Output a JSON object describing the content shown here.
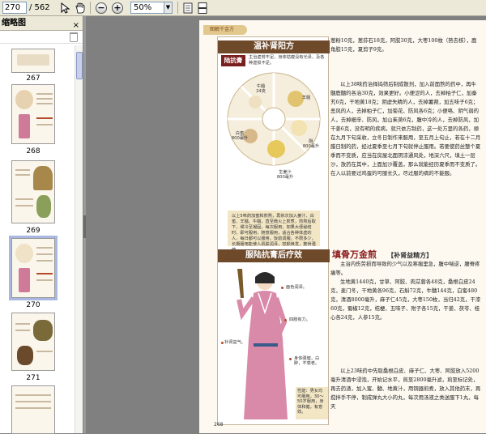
{
  "toolbar": {
    "page_current": "270",
    "page_total": "/ 562",
    "zoom_value": "50%",
    "zoom_out_label": "−",
    "zoom_in_label": "+",
    "zoom_arrow": "▼"
  },
  "sidebar": {
    "title": "缩略图",
    "close_label": "×",
    "thumbnails": [
      {
        "label": "267"
      },
      {
        "label": "268"
      },
      {
        "label": "269"
      },
      {
        "label": "270"
      },
      {
        "label": "271"
      }
    ]
  },
  "page": {
    "section_tab": "图解千金方",
    "box_title": "温补肾阳方",
    "tag": "陆抗膏",
    "tag_note": "主治虚劳不足，身体枯瘦没有光泽，及各种虚损不足。",
    "herbs": [
      {
        "label": "牛髓\n24克"
      },
      {
        "label": "羊髓\n"
      },
      {
        "label": "白蜜\n800毫升"
      },
      {
        "label": "生姜汁\n800毫升"
      },
      {
        "label": "酥\n800毫升"
      }
    ],
    "desc_text": "以上5味药加蜜和煎熬，再依次加入姜汁、白蜜、羊髓、牛髓，直至微火上煎煮，煎熬后取下，候冷至凝固，每次服用，如果大便秘结时，即可服用，随意服用，适合各种体虚的人，每日都可以服用，饭前调服。不限多少，长期服用能使人肌肤润泽，容颜焕发，筋骨强健。",
    "box_title_2": "服陆抗膏后疗效",
    "annotations": [
      {
        "label": "面色润泽。"
      },
      {
        "label": "四肢有力。"
      },
      {
        "label": "补肾益气。"
      },
      {
        "label": "身体强健，白胖，不衰老。"
      }
    ],
    "note_text": "性能：男女均可服用，30～50岁服用，身体和健，有意效。",
    "right_top": "葱粉10克，葱荪石18克，阿胶30克，大枣100枚（熟去核），鹿角胶15克，夏剪子9克。",
    "right_body": "以上38味药治择捣筛后制成散剂，加入前面熬的药中，再牛髓鹿髓的各治30克，效果更好。小便涩的人，去掉柏子仁，加秦艽6克，干地黄18克；阴虚失精的人，去掉薯蓣，加五味子6克；恶风的人，去掉柏子仁，加菊花、防风各6克；小便咯、阴气弱的人，去掉细辛、防风，加山茱萸6克，腹中冷的人，去掉防风，加干姜6克，没有明的疾病，就只依方制药，这一处方里的各药，顺在九月下旬采收，立冬日制作来服用，至五月上旬止，若在十二月腊日制的药，经过夏季至七月下旬就停止服用。若要使药丝整个夏季而不变质，应当在房屋北面阴凉通风处，地深六尺，填土一层沙，放药在其中，上面加沙覆盖，那么就能经历夏季而不变质了。在入以前要过鸡蛋的可服长久，尽过服的病的不能服。",
    "heading_main": "填骨万金煎",
    "heading_sub": "【补肾益精方】",
    "right_lower": "主治内伤劳损而导致的少气以及寒痼里急，腹中喘逆，腰脊疼痛等。",
    "right_recipe": "生地黄1440克，甘草、阿胶、肉苁蓉各48克，桑根白皮24克，麦门冬，干地黄各96克，石斛72克，牛髓144克，白蜜480克，清酒8000毫升，麻子仁45克，大枣150枚，当归42克，干漆60克，蜀椒12克，桔梗、五味子、附子各15克，干姜、茯苓、桂心各24克，人参15克。",
    "right_end": "以上23味药中先取桑根白皮、麻子仁、大枣、阿胶放入5200毫升清酒中浸泡，开始记水平，煎至2800毫升滤，煎至标记处，再去药渣，加入蜜、髓、地黄汁，用铜器煎煮，放入其他药末，再搅拌手不停，制成弹丸大小的丸，每次用汤液之类送服下1丸，每天",
    "folio": "268"
  }
}
